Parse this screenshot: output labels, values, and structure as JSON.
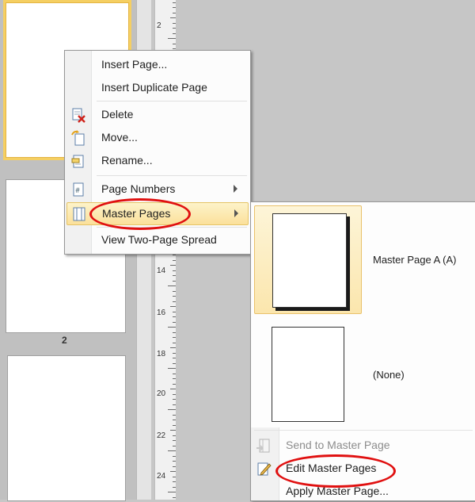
{
  "nav": {
    "thumbnails": [
      {
        "number": ""
      },
      {
        "number": "2"
      },
      {
        "number": ""
      }
    ]
  },
  "ruler": {
    "numbers": [
      "2",
      "14",
      "16",
      "18",
      "20",
      "22",
      "24"
    ]
  },
  "context_menu": {
    "items": [
      {
        "label": "Insert Page...",
        "icon": ""
      },
      {
        "label": "Insert Duplicate Page",
        "icon": ""
      },
      {
        "label": "Delete",
        "icon": "delete-page-icon"
      },
      {
        "label": "Move...",
        "icon": "move-page-icon"
      },
      {
        "label": "Rename...",
        "icon": "rename-page-icon"
      },
      {
        "label": "Page Numbers",
        "icon": "page-numbers-icon"
      },
      {
        "label": "Master Pages",
        "icon": "master-pages-icon"
      },
      {
        "label": "View Two-Page Spread",
        "icon": ""
      }
    ]
  },
  "submenu": {
    "masters": [
      {
        "label": "Master Page A (A)",
        "selected": true
      },
      {
        "label": "(None)",
        "selected": false
      }
    ],
    "items": [
      {
        "label": "Send to Master Page",
        "icon": "send-to-master-icon",
        "disabled": true
      },
      {
        "label": "Edit Master Pages",
        "icon": "edit-master-icon",
        "disabled": false
      },
      {
        "label": "Apply Master Page...",
        "icon": "",
        "disabled": false
      }
    ]
  },
  "colors": {
    "highlight": "#fbe09b",
    "annotation": "#e01010"
  }
}
